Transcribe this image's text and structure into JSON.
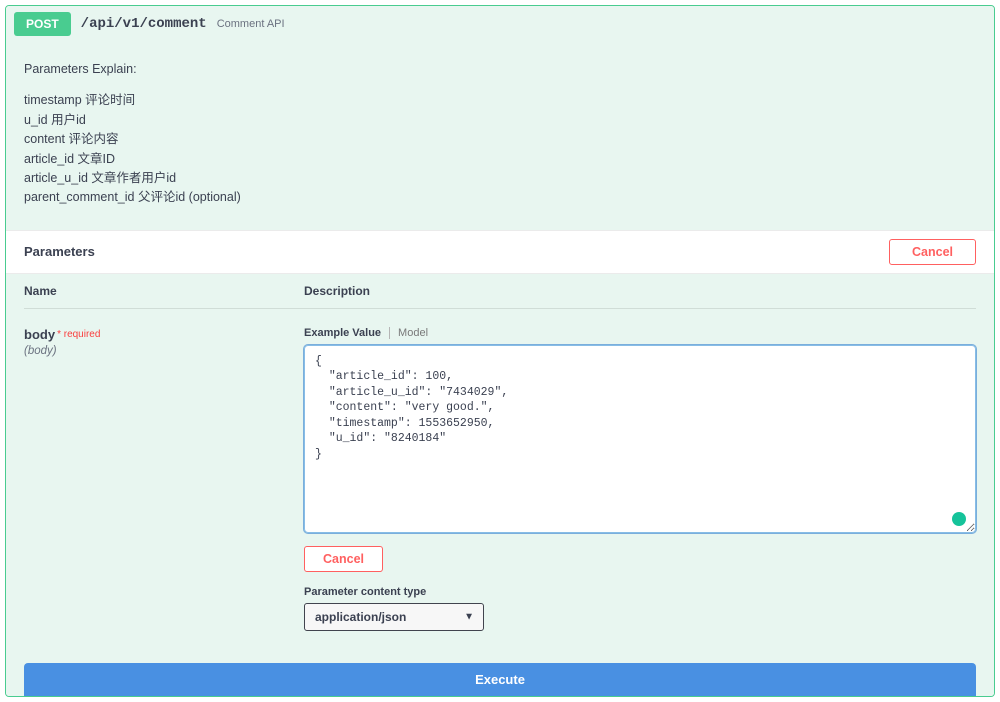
{
  "method": "POST",
  "path": "/api/v1/comment",
  "summary": "Comment API",
  "description": {
    "title": "Parameters Explain:",
    "lines": [
      "timestamp 评论时间",
      "u_id 用户id",
      "content 评论内容",
      "article_id 文章ID",
      "article_u_id 文章作者用户id",
      "parent_comment_id 父评论id (optional)"
    ]
  },
  "parameters_label": "Parameters",
  "cancel_label": "Cancel",
  "columns": {
    "name": "Name",
    "description": "Description"
  },
  "param": {
    "name": "body",
    "required_label": "* required",
    "type": "(body)",
    "tabs": {
      "example": "Example Value",
      "model": "Model"
    },
    "body_value": "{\n  \"article_id\": 100,\n  \"article_u_id\": \"7434029\",\n  \"content\": \"very good.\",\n  \"timestamp\": 1553652950,\n  \"u_id\": \"8240184\"\n}",
    "cancel_label": "Cancel",
    "content_type_label": "Parameter content type",
    "content_type_value": "application/json"
  },
  "execute_label": "Execute"
}
